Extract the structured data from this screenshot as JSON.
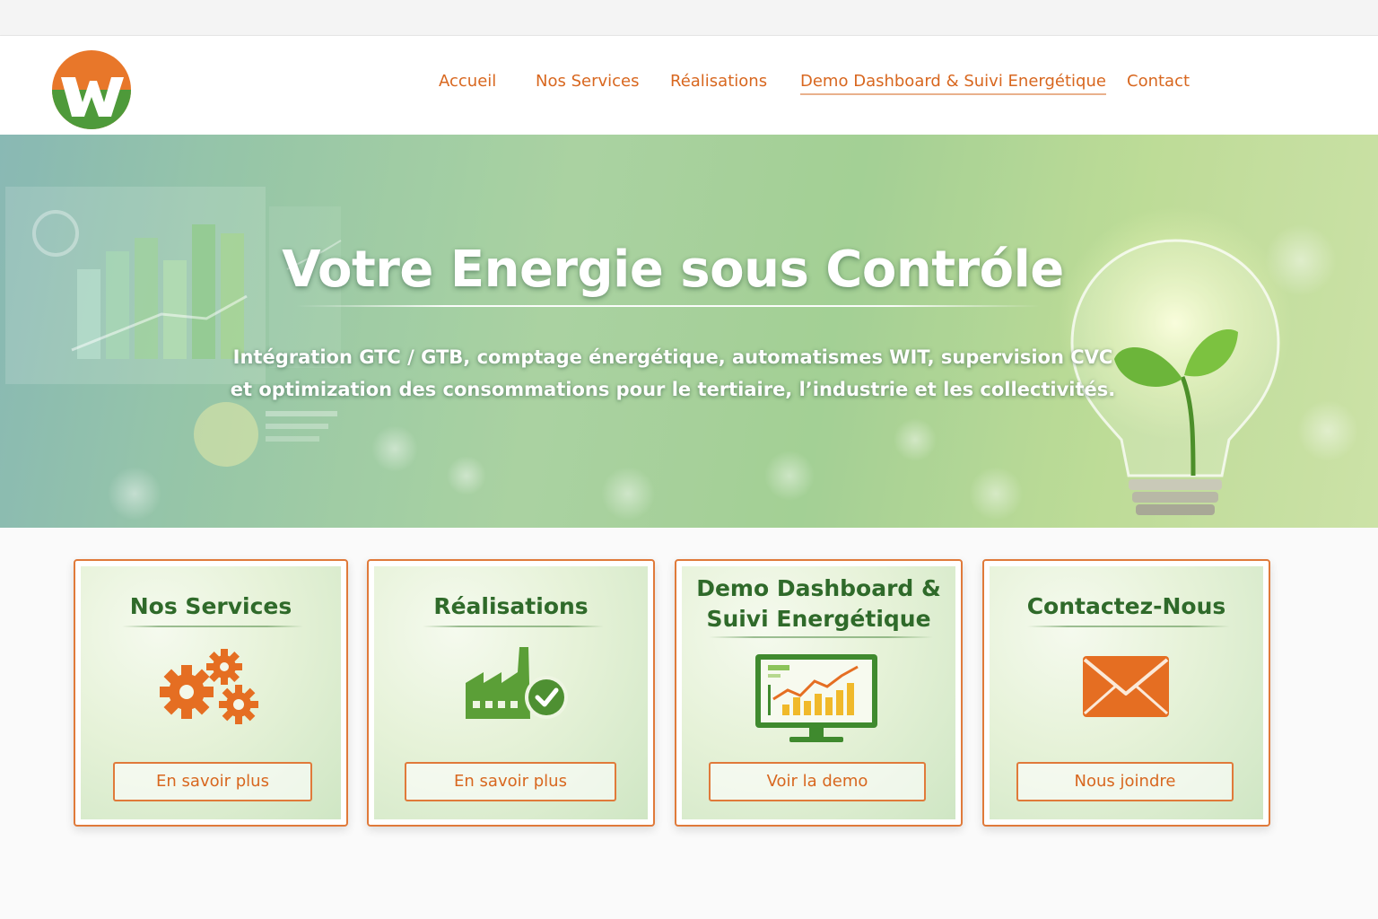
{
  "nav": {
    "items": [
      {
        "label": "Accueil"
      },
      {
        "label": "Nos Services"
      },
      {
        "label": "Réalisations"
      },
      {
        "label": "Demo Dashboard & Suivi Energétique",
        "active": true
      },
      {
        "label": "Contact"
      }
    ]
  },
  "hero": {
    "title": "Votre Energie sous Contróle",
    "subtitle_line1": "Intégration GTC / GTB, comptage énergétique, automatismes WIT, supervision CVC",
    "subtitle_line2": "et optimization des consommations pour le tertiaire, l’industrie et les collectivités."
  },
  "cards": [
    {
      "title": "Nos Services",
      "icon": "gears-icon",
      "button": "En savoir plus"
    },
    {
      "title": "Réalisations",
      "icon": "factory-check-icon",
      "button": "En savoir plus"
    },
    {
      "title_line1": "Demo Dashboard &",
      "title_line2": "Suivi Energétique",
      "icon": "dashboard-monitor-icon",
      "button": "Voir la demo"
    },
    {
      "title": "Contactez-Nous",
      "icon": "envelope-icon",
      "button": "Nous joindre"
    }
  ],
  "colors": {
    "accent_orange": "#d8671f",
    "title_green": "#2f6a2a",
    "logo_orange": "#e8772a",
    "logo_green": "#4e9a3a"
  }
}
